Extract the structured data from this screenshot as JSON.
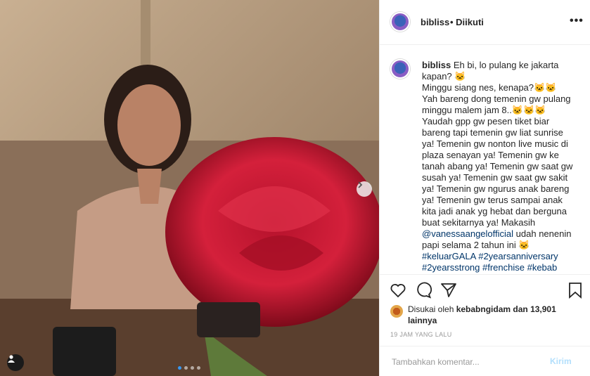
{
  "post": {
    "username": "bibliss",
    "follow_status": "• Diikuti",
    "more_icon": "more-horizontal-icon",
    "caption_text": "Eh bi, lo pulang ke jakarta kapan? 🐱\nMinggu siang nes, kenapa?🐱🐱\nYah bareng dong temenin gw pulang minggu malem jam 8..🐱🐱🐱\nYaudah gpp gw pesen tiket biar bareng tapi temenin gw liat sunrise ya! Temenin gw nonton live music di plaza senayan ya! Temenin gw ke tanah abang ya! Temenin gw saat gw susah ya! Temenin gw saat gw sakit ya! Temenin gw ngurus anak bareng ya! Temenin gw terus sampai anak kita jadi anak yg hebat dan berguna buat sekitarnya ya! Makasih ",
    "mention": "@vanessaangelofficial",
    "caption_after_mention": " udah nenenin papi selama 2 tahun ini 🐱\n",
    "hashtags": "#keluarGALA #2yearsanniversary #2yearsstrong #frenchise #kebab",
    "likes_prefix": "Disukai oleh ",
    "liked_by_user": "kebabngidam",
    "likes_suffix": " dan 13,901 lainnya",
    "timestamp": "19 JAM YANG LALU",
    "comment_placeholder": "Tambahkan komentar...",
    "post_button": "Kirim",
    "carousel": {
      "slides": 4,
      "current": 1
    }
  },
  "colors": {
    "link": "#003569",
    "accent": "#3897f0",
    "post_button": "#b2dffc"
  }
}
